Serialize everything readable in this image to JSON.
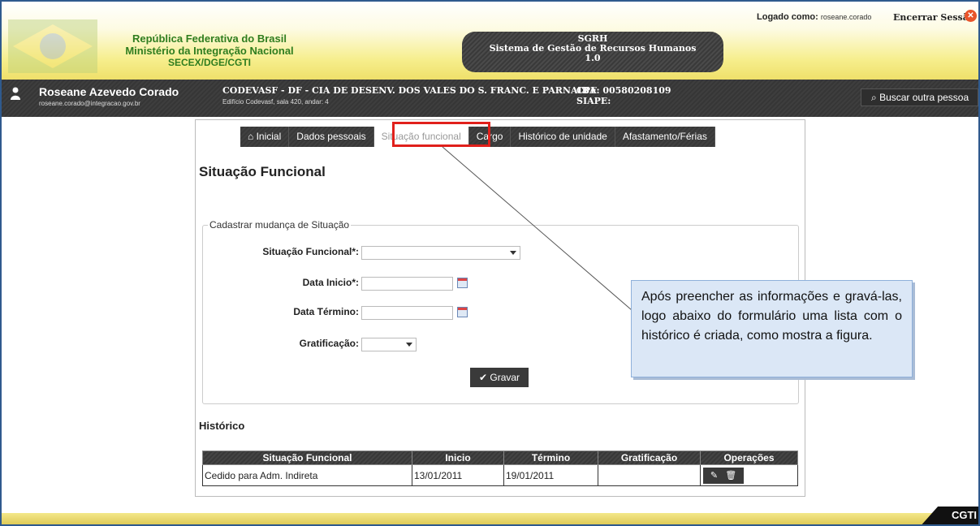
{
  "header": {
    "gov_line1": "República Federativa do Brasil",
    "gov_line2": "Ministério da Integração Nacional",
    "gov_line3": "SECEX/DGE/CGTI",
    "system_short": "SGRH",
    "system_name": "Sistema de Gestão de Recursos Humanos",
    "system_version": "1.0",
    "logged_as_label": "Logado como:",
    "logged_user": "roseane.corado",
    "end_session": "Encerrar Sessão"
  },
  "userbar": {
    "name": "Roseane Azevedo Corado",
    "email": "roseane.corado@integracao.gov.br",
    "org": "CODEVASF - DF - CIA DE DESENV. DOS VALES DO S. FRANC. E PARNAIBA",
    "address": "Edifício Codevasf, sala 420, andar: 4",
    "cpf": "CPF: 00580208109",
    "siape": "SIAPE:",
    "search_other": "Buscar outra pessoa"
  },
  "tabs": [
    {
      "label": "Inicial"
    },
    {
      "label": "Dados pessoais"
    },
    {
      "label": "Situação funcional"
    },
    {
      "label": "Cargo"
    },
    {
      "label": "Histórico de unidade"
    },
    {
      "label": "Afastamento/Férias"
    }
  ],
  "page": {
    "title": "Situação Funcional",
    "fieldset_legend": "Cadastrar mudança de Situação",
    "label_situacao": "Situação Funcional*:",
    "label_data_inicio": "Data Inicio*:",
    "label_data_termino": "Data Término:",
    "label_gratificacao": "Gratificação:",
    "save_label": "Gravar",
    "history_title": "Histórico"
  },
  "table": {
    "headers": [
      "Situação Funcional",
      "Inicio",
      "Término",
      "Gratificação",
      "Operações"
    ],
    "rows": [
      [
        "Cedido para Adm. Indireta",
        "13/01/2011",
        "19/01/2011",
        ""
      ]
    ]
  },
  "callout": {
    "text": "Após preencher as informações e gravá-las, logo abaixo do formulário uma lista com o histórico é criada, como mostra a figura."
  },
  "footer": {
    "logo": "CGTI"
  },
  "colors": {
    "highlight": "#e0201b",
    "dark_bar": "#3a3a3a",
    "gov_green": "#2f7d1f",
    "callout_bg": "#dbe7f6"
  }
}
